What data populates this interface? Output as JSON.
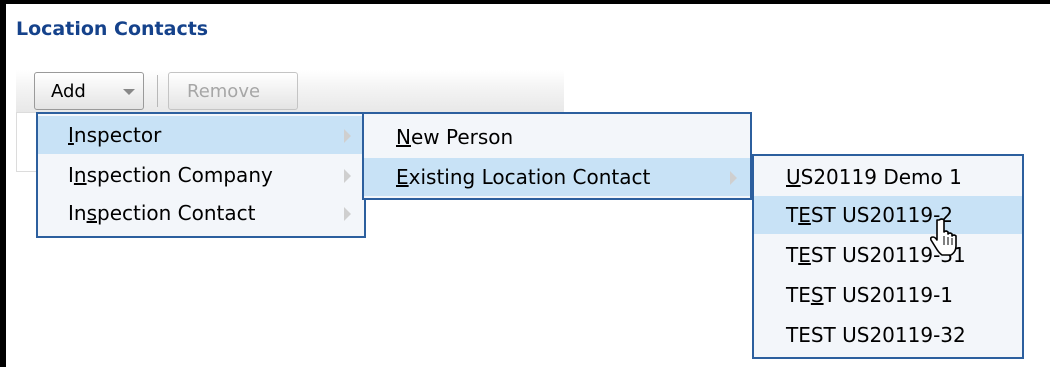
{
  "panel": {
    "title": "Location Contacts"
  },
  "toolbar": {
    "add_label": "Add",
    "remove_label": "Remove"
  },
  "menu1": {
    "items": [
      {
        "pre": "",
        "key": "I",
        "rest": "nspector"
      },
      {
        "pre": "I",
        "key": "n",
        "rest": "spection Company"
      },
      {
        "pre": "In",
        "key": "s",
        "rest": "pection Contact"
      }
    ]
  },
  "menu2": {
    "items": [
      {
        "pre": "",
        "key": "N",
        "rest": "ew Person"
      },
      {
        "pre": "",
        "key": "E",
        "rest": "xisting Location Contact"
      }
    ]
  },
  "menu3": {
    "items": [
      {
        "pre": "",
        "key": "U",
        "rest": "S20119 Demo 1"
      },
      {
        "pre": "T",
        "key": "E",
        "rest": "ST US20119-2"
      },
      {
        "pre": "T",
        "key": "E",
        "rest": "ST US20119-31"
      },
      {
        "pre": "TE",
        "key": "S",
        "rest": "T US20119-1"
      },
      {
        "pre": "",
        "key": "",
        "rest": "TEST US20119-32"
      }
    ]
  },
  "colors": {
    "title": "#15428b",
    "menu_border": "#2c5f9e",
    "active_bg": "#c8e2f6"
  },
  "cursor_icon": "hand-pointer-icon"
}
